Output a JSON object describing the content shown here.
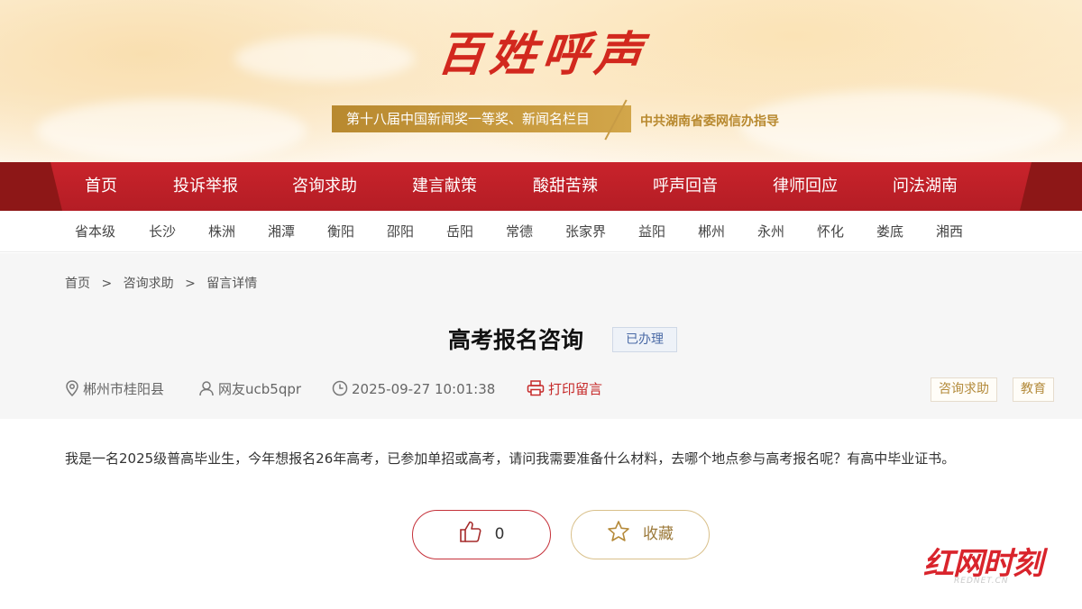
{
  "banner": {
    "title": "百姓呼声",
    "award": "第十八届中国新闻奖一等奖、新闻名栏目",
    "guide": "中共湖南省委网信办指导"
  },
  "nav": {
    "items": [
      "首页",
      "投诉举报",
      "咨询求助",
      "建言献策",
      "酸甜苦辣",
      "呼声回音",
      "律师回应",
      "问法湖南"
    ]
  },
  "cities": [
    "省本级",
    "长沙",
    "株洲",
    "湘潭",
    "衡阳",
    "邵阳",
    "岳阳",
    "常德",
    "张家界",
    "益阳",
    "郴州",
    "永州",
    "怀化",
    "娄底",
    "湘西"
  ],
  "breadcrumb": {
    "home": "首页",
    "sep": ">",
    "section": "咨询求助",
    "current": "留言详情"
  },
  "post": {
    "title": "高考报名咨询",
    "status": "已办理",
    "location": "郴州市桂阳县",
    "author": "网友ucb5qpr",
    "datetime": "2025-09-27 10:01:38",
    "print_label": "打印留言",
    "tags": [
      "咨询求助",
      "教育"
    ],
    "content": "我是一名2025级普高毕业生，今年想报名26年高考，已参加单招或高考，请问我需要准备什么材料，去哪个地点参与高考报名呢？有高中毕业证书。",
    "like_count": "0",
    "favorite_label": "收藏"
  },
  "watermark": {
    "logo": "红网时刻",
    "sub": "REDNET.CN"
  },
  "colors": {
    "brand_red": "#c9232b",
    "gold": "#b8892f",
    "status_blue": "#4a6aa6"
  },
  "icons": [
    "location-icon",
    "user-icon",
    "clock-icon",
    "printer-icon",
    "thumbs-up-icon",
    "star-icon"
  ]
}
